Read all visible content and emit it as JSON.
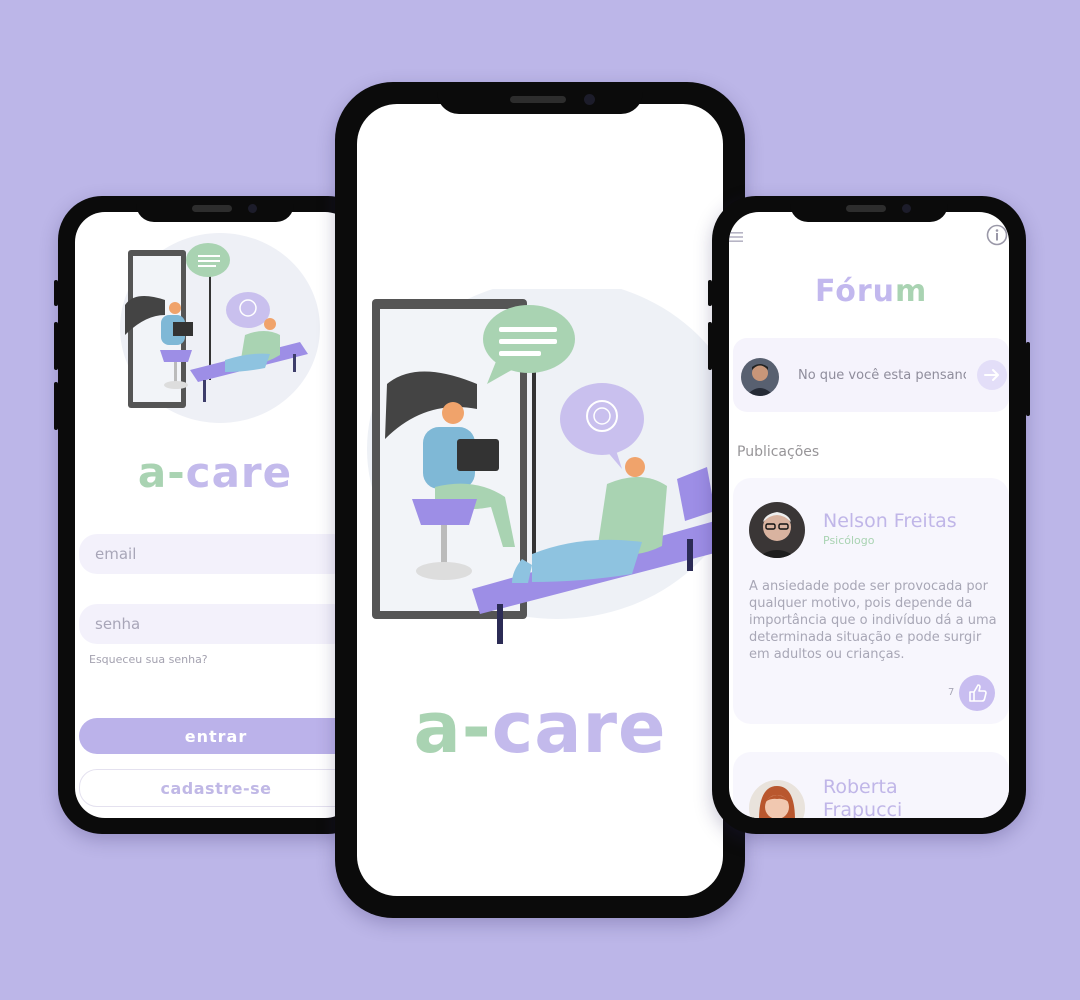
{
  "brand": {
    "logo_prefix": "a-",
    "logo_suffix": "care"
  },
  "login": {
    "email_placeholder": "email",
    "password_placeholder": "senha",
    "forgot_password": "Esqueceu sua senha?",
    "login_button": "entrar",
    "signup_button": "cadastre-se"
  },
  "forum": {
    "title_part1": "Fóru",
    "title_part2": "m",
    "compose_placeholder": "No que você esta pensanc",
    "section_label": "Publicações",
    "posts": [
      {
        "author": "Nelson Freitas",
        "role": "Psicólogo",
        "text": "A ansiedade pode ser provocada por qualquer motivo, pois depende da importância que o indivíduo dá a uma determinada situação e pode surgir em adultos ou crianças.",
        "likes": "7"
      },
      {
        "author": "Roberta",
        "author_line2": "Frapucci"
      }
    ]
  },
  "colors": {
    "background": "#bcb6e8",
    "accent_purple": "#bbb2ea",
    "accent_green": "#a9d3b2",
    "text_muted": "#a8a6b8"
  },
  "icons": [
    "menu-icon",
    "info-icon",
    "arrow-right-icon",
    "thumbs-up-icon"
  ]
}
